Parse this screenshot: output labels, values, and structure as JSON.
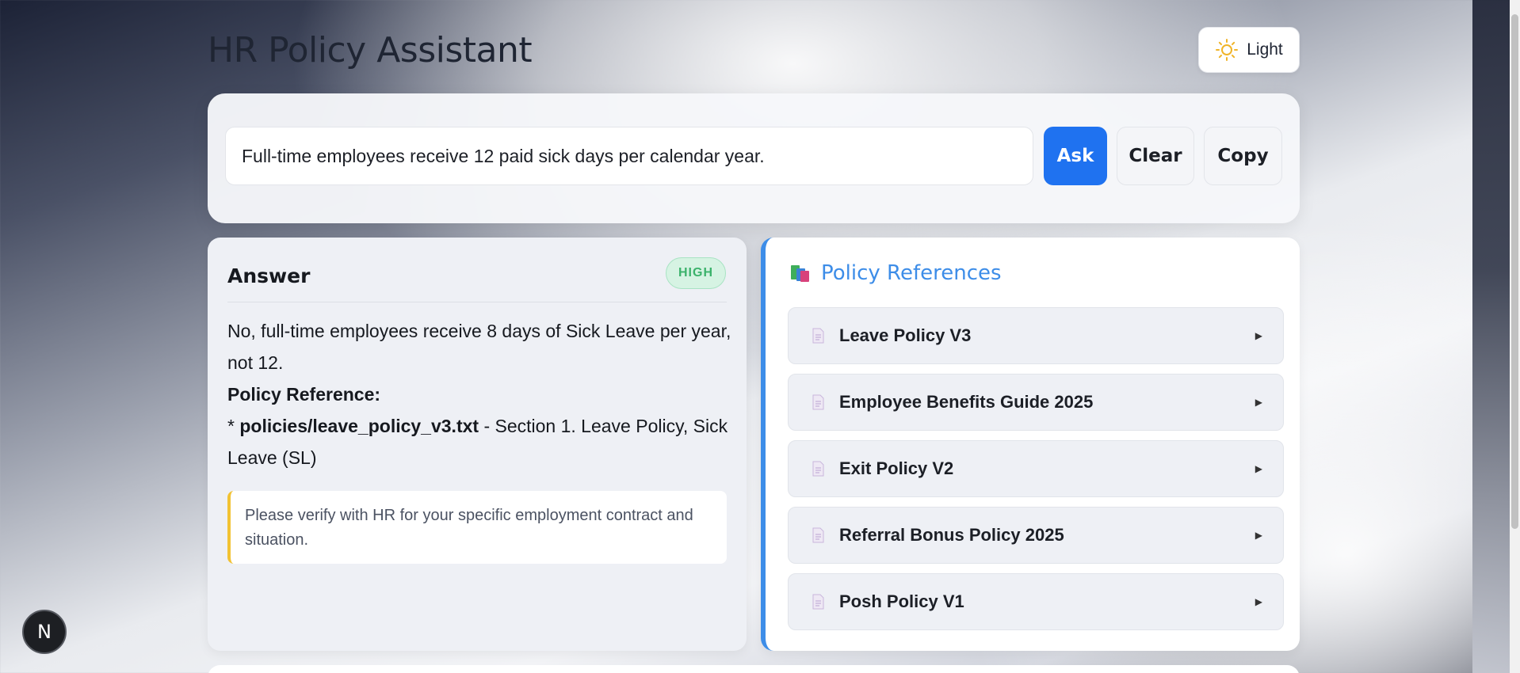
{
  "header": {
    "title": "HR Policy Assistant",
    "theme_label": "Light"
  },
  "query": {
    "value": "Full-time employees receive 12 paid sick days per calendar year.",
    "ask_label": "Ask",
    "clear_label": "Clear",
    "copy_label": "Copy"
  },
  "answer": {
    "title": "Answer",
    "confidence": "HIGH",
    "line1": "No, full-time employees receive 8 days of Sick Leave per year, not 12.",
    "reference_heading": "Policy Reference:",
    "bullet": "* ",
    "ref_file": "policies/leave_policy_v3.txt",
    "ref_detail": " - Section 1. Leave Policy, Sick Leave (SL)",
    "note": "Please verify with HR for your specific employment contract and situation."
  },
  "references": {
    "title": "Policy References",
    "items": [
      {
        "name": "Leave Policy V3"
      },
      {
        "name": "Employee Benefits Guide 2025"
      },
      {
        "name": "Exit Policy V2"
      },
      {
        "name": "Referral Bonus Policy 2025"
      },
      {
        "name": "Posh Policy V1"
      }
    ]
  },
  "dev_badge": "N"
}
